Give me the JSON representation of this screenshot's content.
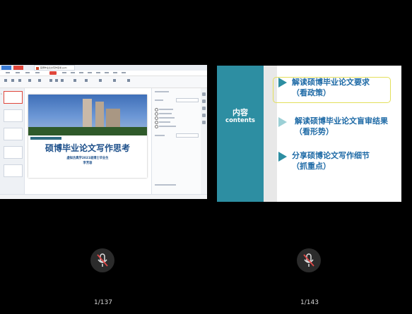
{
  "left_tile": {
    "editor": {
      "doc_tab": "硕博毕业论文写作思考.pptx",
      "slide": {
        "title": "硕博毕业论文写作思考",
        "subtitle_line1": "虚拟仿真学2021级博士毕业生",
        "subtitle_line2": "李芳容"
      }
    },
    "page_counter": "1/137"
  },
  "right_tile": {
    "slide": {
      "heading": "内容",
      "heading_en": "contents",
      "items": [
        {
          "line1": "解读硕博毕业论文要求",
          "line2": "（看政策）"
        },
        {
          "line1": "解读硕博毕业论文盲审结果",
          "line2": "（看形势）"
        },
        {
          "line1": "分享硕博论文写作细节",
          "line2": "（抓重点）"
        }
      ]
    },
    "page_counter": "1/143"
  },
  "colors": {
    "teal": "#2d8ea2",
    "title_blue": "#1c4f8a",
    "item_blue": "#1e6aa6",
    "highlight": "#e3df5a",
    "background": "#000000"
  },
  "icons": {
    "mic_left": "mic-muted-icon",
    "mic_right": "mic-muted-icon"
  }
}
